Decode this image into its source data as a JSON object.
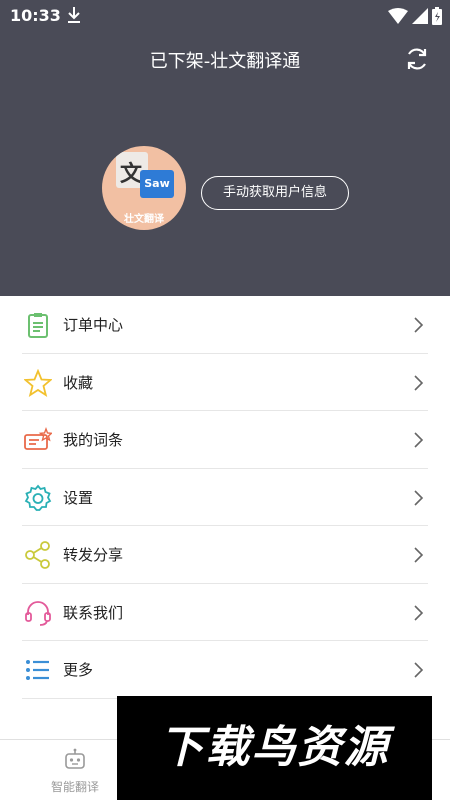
{
  "status_bar": {
    "time": "10:33"
  },
  "header": {
    "title": "已下架-壮文翻译通"
  },
  "avatar": {
    "glyph": "文",
    "card": "Saw",
    "brand": "壮文翻译"
  },
  "profile": {
    "fetch_button": "手动获取用户信息"
  },
  "menu": {
    "items": [
      {
        "label": "订单中心",
        "icon": "clipboard-icon",
        "color": "#6cc070"
      },
      {
        "label": "收藏",
        "icon": "star-icon",
        "color": "#f2c12e"
      },
      {
        "label": "我的词条",
        "icon": "ticket-icon",
        "color": "#e96a4a"
      },
      {
        "label": "设置",
        "icon": "gear-icon",
        "color": "#2ab0b5"
      },
      {
        "label": "转发分享",
        "icon": "share-icon",
        "color": "#c9c93a"
      },
      {
        "label": "联系我们",
        "icon": "headset-icon",
        "color": "#e35a9a"
      },
      {
        "label": "更多",
        "icon": "list-icon",
        "color": "#3b8fd6"
      }
    ]
  },
  "bottom_nav": {
    "tabs": [
      {
        "label": "智能翻译",
        "icon": "robot-icon"
      }
    ]
  },
  "watermark": {
    "text": "下载鸟资源"
  },
  "colors": {
    "header_bg": "#4a4b57",
    "divider": "#e6e6e6"
  }
}
